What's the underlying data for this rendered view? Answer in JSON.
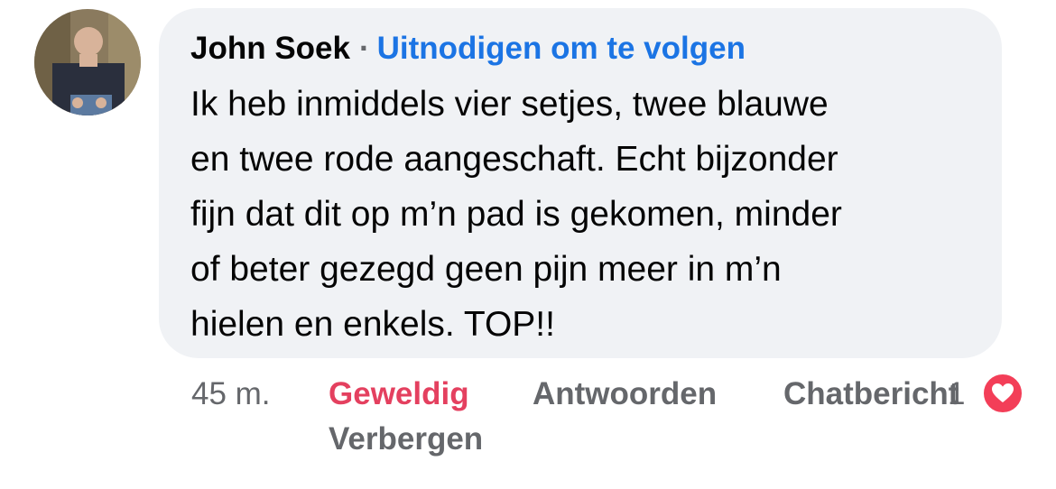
{
  "comment": {
    "author": "John Soek",
    "separator": "·",
    "follow_link": "Uitnodigen om te volgen",
    "text_lines": [
      "Ik heb inmiddels vier setjes, twee blauwe",
      "en twee rode aangeschaft. Echt bijzonder",
      "fijn dat dit op m’n pad is gekomen, minder",
      "of beter gezegd geen pijn meer in m’n",
      "hielen en enkels. TOP!!"
    ]
  },
  "actions": {
    "timestamp": "45 m.",
    "reaction": "Geweldig",
    "reply": "Antwoorden",
    "chat": "Chatbericht",
    "hide": "Verbergen"
  },
  "reactions": {
    "count": "1",
    "icon": "heart-icon",
    "color": "#f33e58"
  },
  "colors": {
    "bubble": "#f0f2f5",
    "link": "#1b74e4",
    "reaction_active": "#e4405f",
    "secondary_text": "#65676b"
  }
}
